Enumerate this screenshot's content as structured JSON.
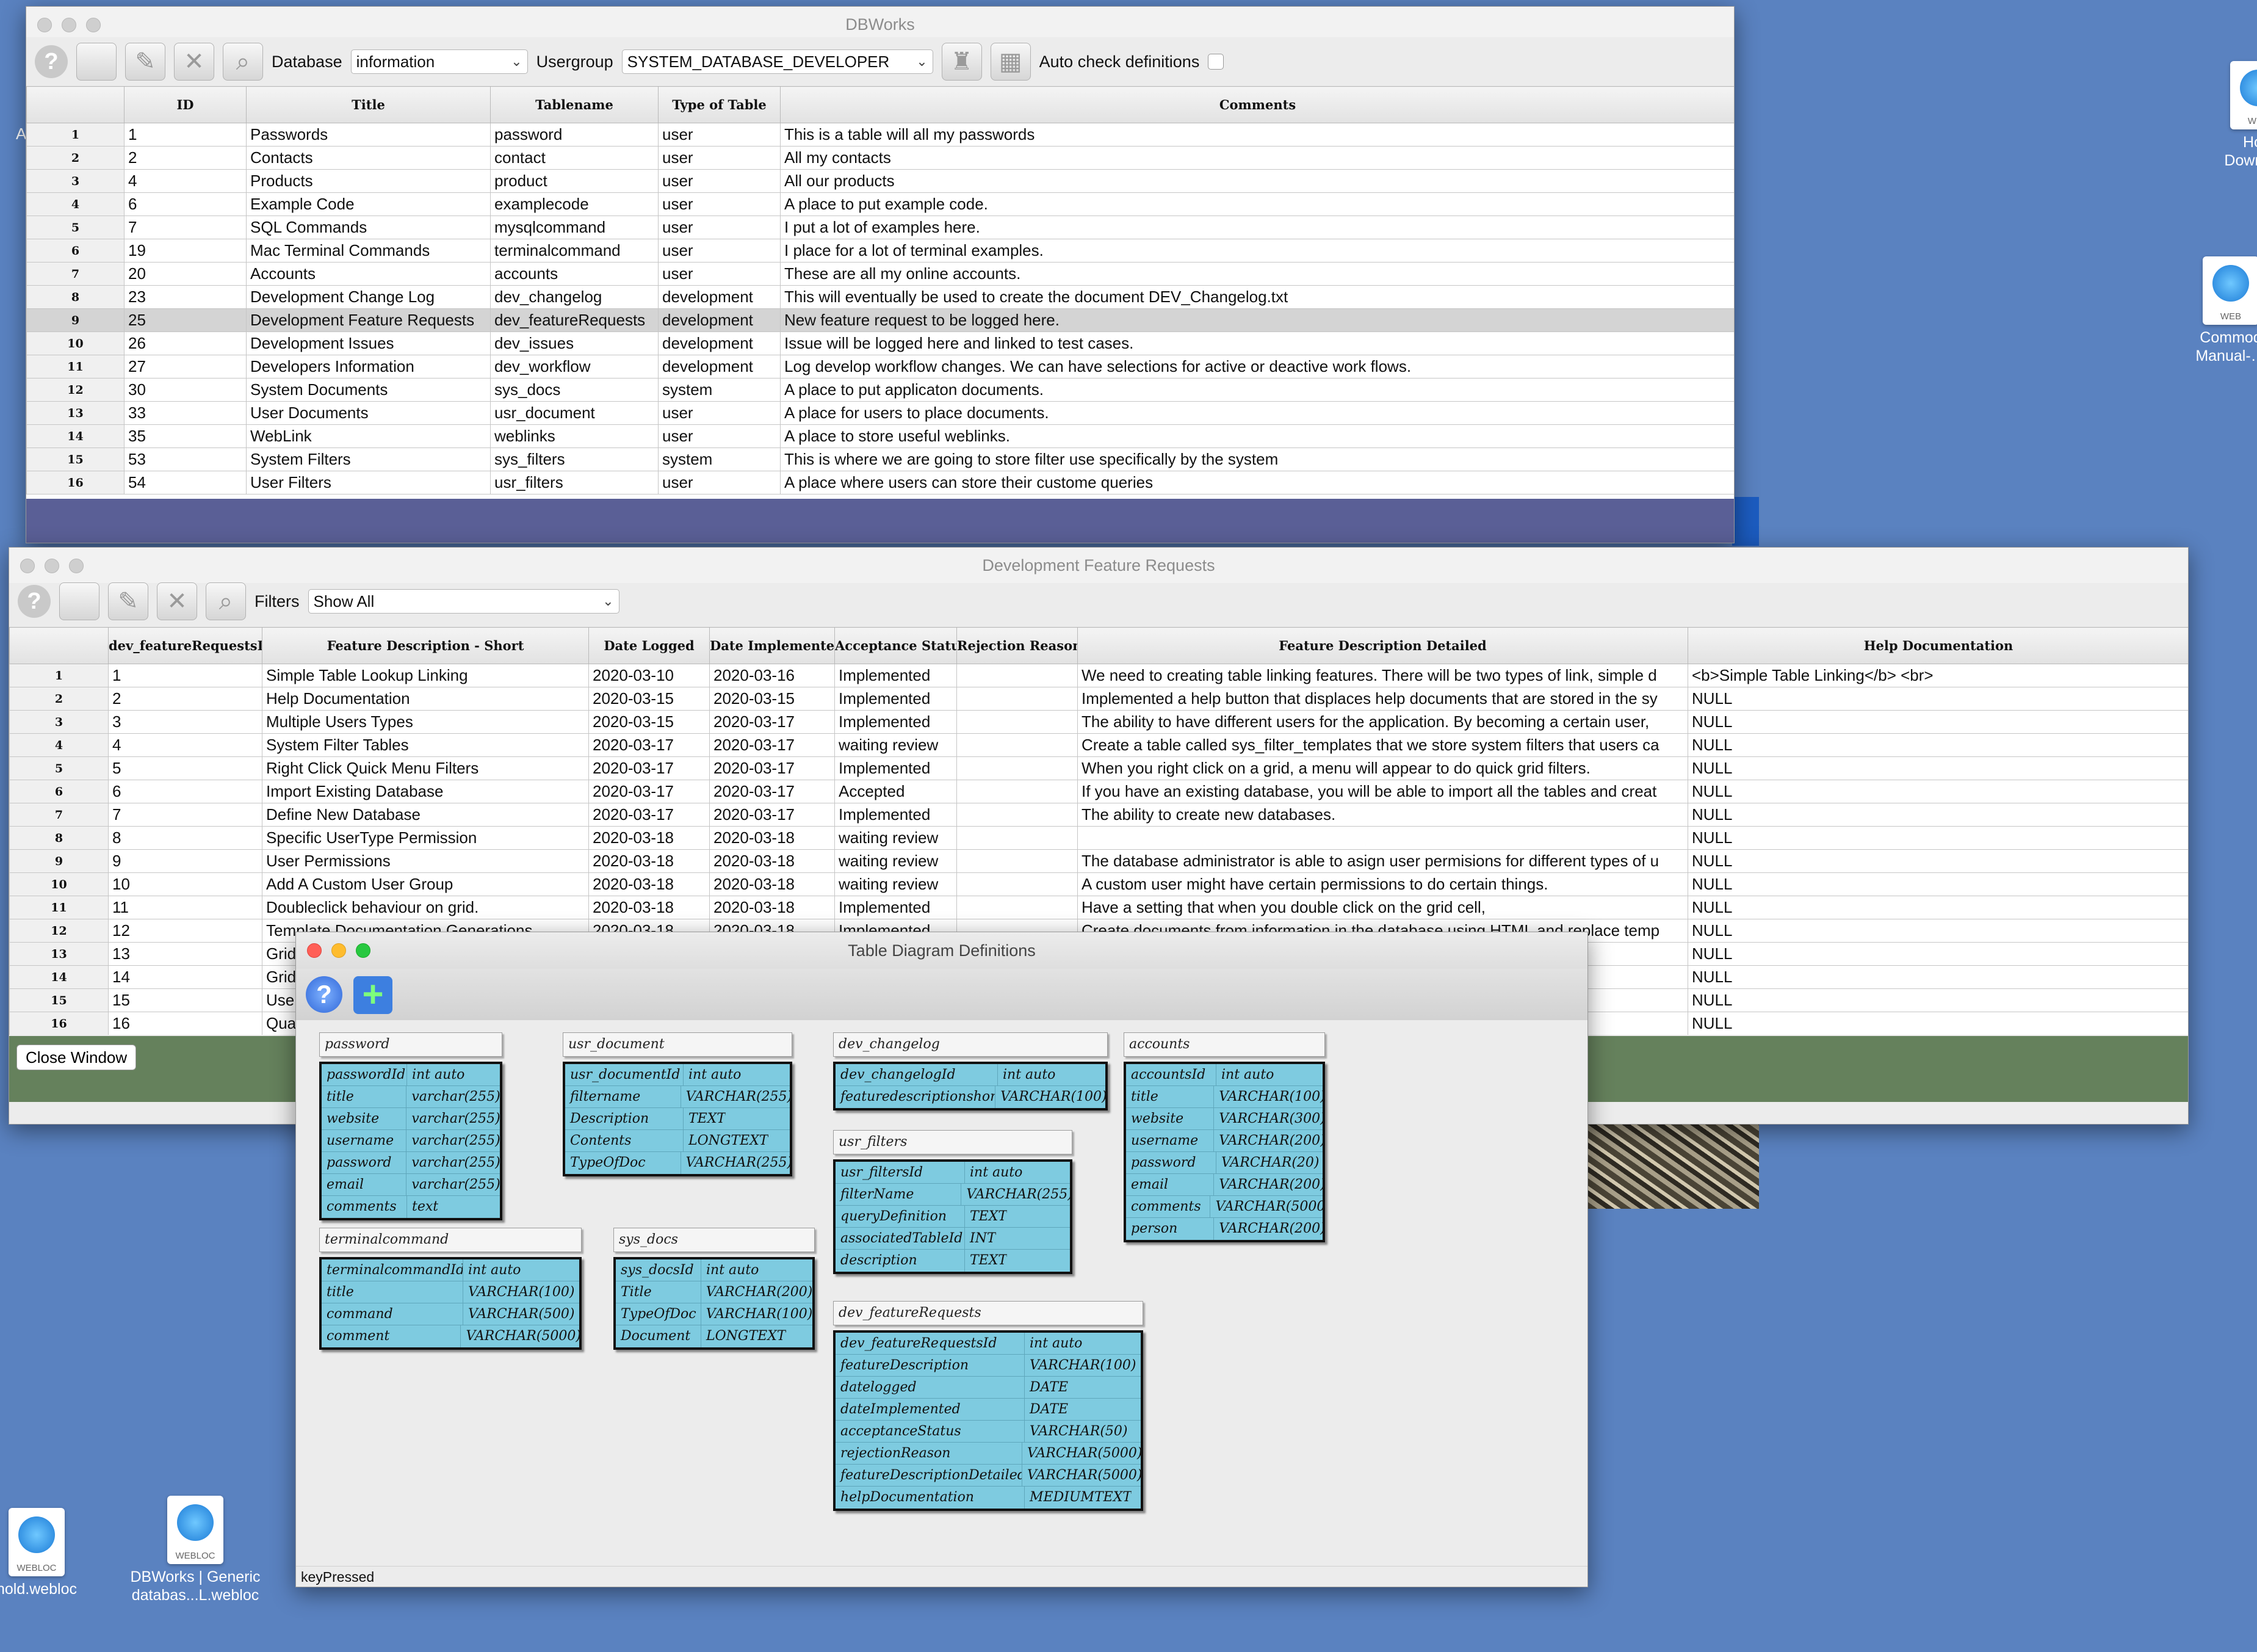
{
  "desktop": {
    "icons": [
      {
        "id": "how",
        "label": "How Downgr…",
        "badge": "WEB"
      },
      {
        "id": "commodore",
        "label": "Commod Manual-…",
        "badge": "WEB"
      },
      {
        "id": "hold",
        "label": "hold.webloc",
        "badge": "WEBLOC"
      },
      {
        "id": "dbworks",
        "label": "DBWorks | Generic databas...L.webloc",
        "badge": "WEBLOC"
      }
    ],
    "left_edge_letter": "A"
  },
  "main_window": {
    "title": "DBWorks",
    "database_label": "Database",
    "database_value": "information",
    "usergroup_label": "Usergroup",
    "usergroup_value": "SYSTEM_DATABASE_DEVELOPER",
    "auto_check_label": "Auto check definitions",
    "columns": [
      "ID",
      "Title",
      "Tablename",
      "Type of Table",
      "Comments"
    ],
    "selected_row": 9,
    "rows": [
      [
        "1",
        "1",
        "Passwords",
        "password",
        "user",
        "This is a table will all my passwords"
      ],
      [
        "2",
        "2",
        "Contacts",
        "contact",
        "user",
        "All my contacts"
      ],
      [
        "3",
        "4",
        "Products",
        "product",
        "user",
        "All our products"
      ],
      [
        "4",
        "6",
        "Example Code",
        "examplecode",
        "user",
        "A place to put example code."
      ],
      [
        "5",
        "7",
        "SQL Commands",
        "mysqlcommand",
        "user",
        "I put a lot of examples here."
      ],
      [
        "6",
        "19",
        "Mac Terminal Commands",
        "terminalcommand",
        "user",
        "I place for a lot of terminal examples."
      ],
      [
        "7",
        "20",
        "Accounts",
        "accounts",
        "user",
        "These are all my online accounts."
      ],
      [
        "8",
        "23",
        "Development Change Log",
        "dev_changelog",
        "development",
        "This will eventually be used to create the document DEV_Changelog.txt"
      ],
      [
        "9",
        "25",
        "Development Feature Requests",
        "dev_featureRequests",
        "development",
        "New feature request to be logged here."
      ],
      [
        "10",
        "26",
        "Development Issues",
        "dev_issues",
        "development",
        "Issue will be logged here and linked to test cases."
      ],
      [
        "11",
        "27",
        "Developers Information",
        "dev_workflow",
        "development",
        "Log develop workflow changes. We can have selections for active or deactive work flows."
      ],
      [
        "12",
        "30",
        "System Documents",
        "sys_docs",
        "system",
        "A place to put applicaton documents."
      ],
      [
        "13",
        "33",
        "User Documents",
        "usr_document",
        "user",
        "A place for users to place documents."
      ],
      [
        "14",
        "35",
        "WebLink",
        "weblinks",
        "user",
        "A place to store useful weblinks."
      ],
      [
        "15",
        "53",
        "System Filters",
        "sys_filters",
        "system",
        "This is where we are going to store filter use specifically by the system"
      ],
      [
        "16",
        "54",
        "User Filters",
        "usr_filters",
        "user",
        "A place where users can store their custome queries"
      ]
    ]
  },
  "feature_window": {
    "title": "Development Feature Requests",
    "filters_label": "Filters",
    "filters_value": "Show All",
    "columns": [
      "dev_featureRequestsId *",
      "Feature Description - Short",
      "Date Logged",
      "Date Implemented",
      "Acceptance Status",
      "Rejection Reason",
      "Feature Description Detailed",
      "Help Documentation"
    ],
    "rows": [
      [
        "1",
        "1",
        "Simple Table Lookup Linking",
        "2020-03-10",
        "2020-03-16",
        "Implemented",
        "",
        "We need to creating table linking features. There will be two types of link, simple d",
        "<b>Simple Table Linking</b> <br>"
      ],
      [
        "2",
        "2",
        "Help Documentation",
        "2020-03-15",
        "2020-03-15",
        "Implemented",
        "",
        "Implemented a help button that displaces help documents that are stored in the sy",
        "NULL"
      ],
      [
        "3",
        "3",
        "Multiple Users Types",
        "2020-03-15",
        "2020-03-17",
        "Implemented",
        "",
        "The ability to have different users for the application. By becoming a certain user,",
        "NULL"
      ],
      [
        "4",
        "4",
        "System Filter Tables",
        "2020-03-17",
        "2020-03-17",
        "waiting review",
        "",
        "Create a table called sys_filter_templates that we store system filters that users ca",
        "NULL"
      ],
      [
        "5",
        "5",
        "Right Click Quick Menu Filters",
        "2020-03-17",
        "2020-03-17",
        "Implemented",
        "",
        "When you right click on a grid, a menu will appear to do quick grid filters.",
        "NULL"
      ],
      [
        "6",
        "6",
        "Import Existing Database",
        "2020-03-17",
        "2020-03-17",
        "Accepted",
        "",
        "If you have an existing database, you will be able to import all the tables and creat",
        "NULL"
      ],
      [
        "7",
        "7",
        "Define New Database",
        "2020-03-17",
        "2020-03-17",
        "Implemented",
        "",
        "The ability to create new databases.",
        "NULL"
      ],
      [
        "8",
        "8",
        "Specific UserType Permission",
        "2020-03-18",
        "2020-03-18",
        "waiting review",
        "",
        "",
        "NULL"
      ],
      [
        "9",
        "9",
        "User Permissions",
        "2020-03-18",
        "2020-03-18",
        "waiting review",
        "",
        "The database administrator is able to asign user permisions for different types of u",
        "NULL"
      ],
      [
        "10",
        "10",
        "Add A Custom User Group",
        "2020-03-18",
        "2020-03-18",
        "waiting review",
        "",
        "A custom user might have certain permissions to do certain things.",
        "NULL"
      ],
      [
        "11",
        "11",
        "Doubleclick behaviour on grid.",
        "2020-03-18",
        "2020-03-18",
        "Implemented",
        "",
        "Have a setting that when you double click on the grid cell,",
        "NULL"
      ],
      [
        "12",
        "12",
        "Template Documentation Generations",
        "2020-03-18",
        "2020-03-18",
        "Implemented",
        "",
        "Create documents from information in the database using HTML and replace temp",
        "NULL"
      ],
      [
        "13",
        "13",
        "Grid",
        "",
        "",
        "",
        "",
        "",
        "NULL"
      ],
      [
        "14",
        "14",
        "Grid",
        "",
        "",
        "",
        "",
        "",
        "NULL"
      ],
      [
        "15",
        "15",
        "User",
        "",
        "",
        "",
        "",
        "plication deve",
        "NULL"
      ],
      [
        "16",
        "16",
        "Qua",
        "",
        "",
        "",
        "",
        "e qualified to",
        "NULL"
      ]
    ],
    "close_button": "Close Window"
  },
  "diagram_window": {
    "title": "Table Diagram Definitions",
    "status_text": "keyPressed",
    "tables": [
      {
        "id": "password",
        "name": "password",
        "fields": [
          [
            "passwordId",
            "int auto"
          ],
          [
            "title",
            "varchar(255)"
          ],
          [
            "website",
            "varchar(255)"
          ],
          [
            "username",
            "varchar(255)"
          ],
          [
            "password",
            "varchar(255)"
          ],
          [
            "email",
            "varchar(255)"
          ],
          [
            "comments",
            "text"
          ]
        ]
      },
      {
        "id": "usr_document",
        "name": "usr_document",
        "fields": [
          [
            "usr_documentId",
            "int auto"
          ],
          [
            "filtername",
            "VARCHAR(255)"
          ],
          [
            "Description",
            "TEXT"
          ],
          [
            "Contents",
            "LONGTEXT"
          ],
          [
            "TypeOfDoc",
            "VARCHAR(255)"
          ]
        ]
      },
      {
        "id": "dev_changelog",
        "name": "dev_changelog",
        "fields": [
          [
            "dev_changelogId",
            "int auto"
          ],
          [
            "featuredescriptionshort",
            "VARCHAR(100)"
          ]
        ]
      },
      {
        "id": "accounts",
        "name": "accounts",
        "fields": [
          [
            "accountsId",
            "int auto"
          ],
          [
            "title",
            "VARCHAR(100)"
          ],
          [
            "website",
            "VARCHAR(300)"
          ],
          [
            "username",
            "VARCHAR(200)"
          ],
          [
            "password",
            "VARCHAR(20)"
          ],
          [
            "email",
            "VARCHAR(200)"
          ],
          [
            "comments",
            "VARCHAR(5000)"
          ],
          [
            "person",
            "VARCHAR(200)"
          ]
        ]
      },
      {
        "id": "usr_filters",
        "name": "usr_filters",
        "fields": [
          [
            "usr_filtersId",
            "int auto"
          ],
          [
            "filterName",
            "VARCHAR(255)"
          ],
          [
            "queryDefinition",
            "TEXT"
          ],
          [
            "associatedTableId",
            "INT"
          ],
          [
            "description",
            "TEXT"
          ]
        ]
      },
      {
        "id": "terminalcommand",
        "name": "terminalcommand",
        "fields": [
          [
            "terminalcommandId",
            "int auto"
          ],
          [
            "title",
            "VARCHAR(100)"
          ],
          [
            "command",
            "VARCHAR(500)"
          ],
          [
            "comment",
            "VARCHAR(5000)"
          ]
        ]
      },
      {
        "id": "sys_docs",
        "name": "sys_docs",
        "fields": [
          [
            "sys_docsId",
            "int auto"
          ],
          [
            "Title",
            "VARCHAR(200)"
          ],
          [
            "TypeOfDoc",
            "VARCHAR(100)"
          ],
          [
            "Document",
            "LONGTEXT"
          ]
        ]
      },
      {
        "id": "dev_featureRequests",
        "name": "dev_featureRequests",
        "fields": [
          [
            "dev_featureRequestsId",
            "int auto"
          ],
          [
            "featureDescription",
            "VARCHAR(100)"
          ],
          [
            "datelogged",
            "DATE"
          ],
          [
            "dateImplemented",
            "DATE"
          ],
          [
            "acceptanceStatus",
            "VARCHAR(50)"
          ],
          [
            "rejectionReason",
            "VARCHAR(5000)"
          ],
          [
            "featureDescriptionDetailed",
            "VARCHAR(5000)"
          ],
          [
            "helpDocumentation",
            "MEDIUMTEXT"
          ]
        ]
      }
    ]
  }
}
